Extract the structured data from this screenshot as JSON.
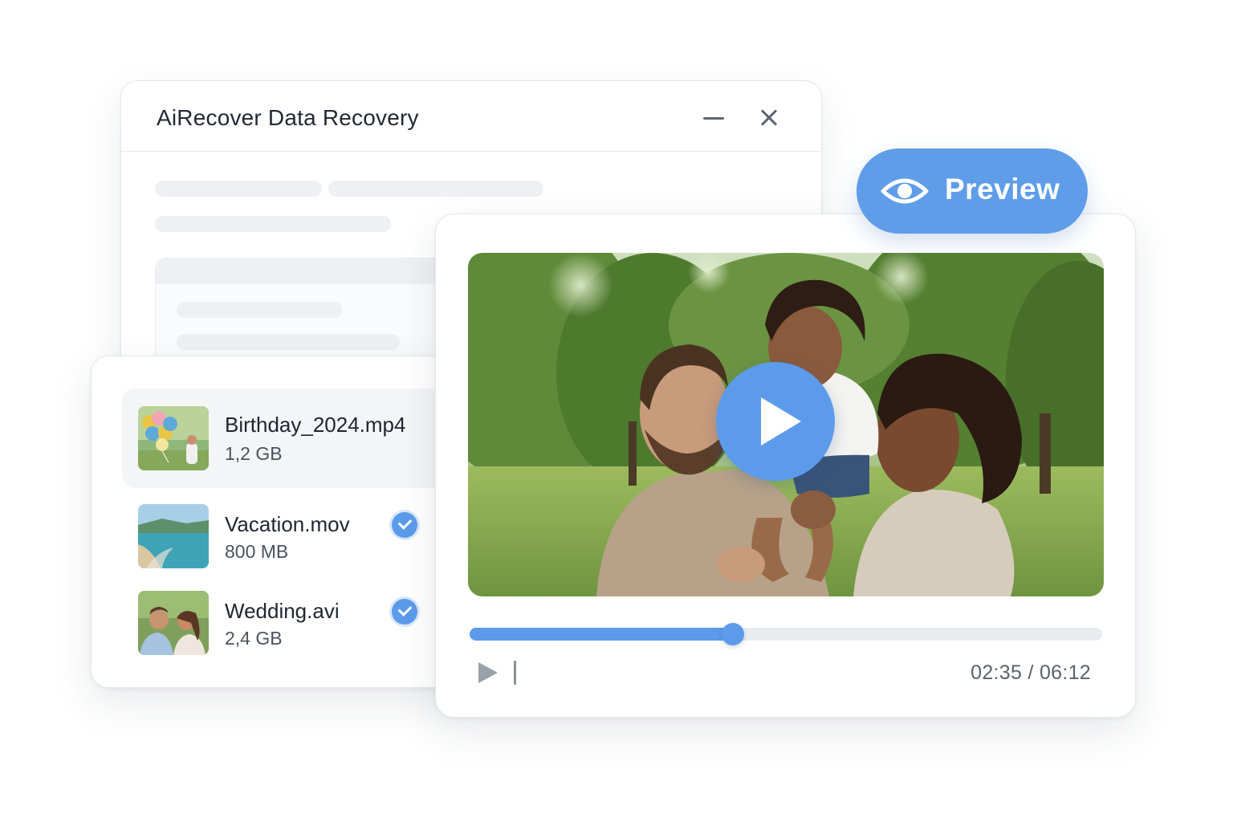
{
  "window": {
    "title": "AiRecover Data Recovery",
    "minimize_icon": "minimize-icon",
    "close_icon": "close-icon"
  },
  "files": [
    {
      "name": "Birthday_2024.mp4",
      "size": "1,2 GB",
      "checked": false,
      "selected": true,
      "thumbnail": "balloons-thumbnail"
    },
    {
      "name": "Vacation.mov",
      "size": "800 MB",
      "checked": true,
      "selected": false,
      "thumbnail": "beach-thumbnail"
    },
    {
      "name": "Wedding.avi",
      "size": "2,4 GB",
      "checked": true,
      "selected": false,
      "thumbnail": "couple-thumbnail"
    }
  ],
  "player": {
    "preview_label": "Preview",
    "preview_icon": "eye-icon",
    "play_icon": "play-icon",
    "time": "02:35 / 06:12",
    "progress": 0.4167
  },
  "colors": {
    "accent": "#5b9bea",
    "track": "#e9ecef",
    "skeleton": "#eef0f3"
  }
}
